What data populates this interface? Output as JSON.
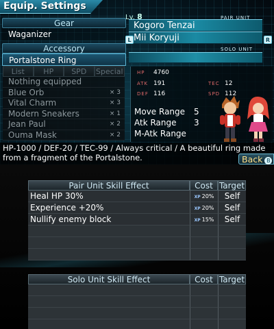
{
  "screen_title": "Equip. Settings",
  "gear": {
    "header": "Gear",
    "slot": "Waganizer"
  },
  "accessory": {
    "header": "Accessory",
    "slot": "Portalstone Ring"
  },
  "list_tabs": [
    "List",
    "HP",
    "SPD",
    "Special"
  ],
  "inventory": [
    {
      "name": "Nothing equipped",
      "qty": ""
    },
    {
      "name": "Blue Orb",
      "qty": "× 3"
    },
    {
      "name": "Vital Charm",
      "qty": "× 3"
    },
    {
      "name": "Modern Sneakers",
      "qty": "× 1"
    },
    {
      "name": "Jean Paul",
      "qty": "× 2"
    },
    {
      "name": "Ouma Mask",
      "qty": "× 2"
    }
  ],
  "level": {
    "label": "Lv.",
    "value": "8"
  },
  "pair_unit_label": "PAIR UNIT",
  "solo_unit_label": "SOLO UNIT",
  "units": {
    "unit1": "Kogoro Tenzai",
    "unit2": "Mii Koryuji"
  },
  "buttons": {
    "l": "L",
    "r": "R",
    "b": "B"
  },
  "stats": {
    "hp": {
      "k": "HP",
      "v": "4760"
    },
    "atk": {
      "k": "ATK",
      "v": "191"
    },
    "def": {
      "k": "DEF",
      "v": "116"
    },
    "tec": {
      "k": "TEC",
      "v": "12"
    },
    "spd": {
      "k": "SPD",
      "v": "112"
    }
  },
  "moves": {
    "move_range": {
      "label": "Move Range",
      "value": "5"
    },
    "atk_range": {
      "label": "Atk Range",
      "value": "3"
    },
    "matk_range": {
      "label": "M-Atk Range",
      "value": ""
    }
  },
  "description": "HP-1000 / DEF-20 / TEC-99 / Always critical / A beautiful ring made from a fragment of the Portalstone.",
  "back_label": "Back",
  "pair_skills": {
    "header": {
      "effect": "Pair Unit Skill Effect",
      "cost": "Cost",
      "target": "Target"
    },
    "rows": [
      {
        "effect": "Heal HP 30%",
        "cost": "20%",
        "target": "Self"
      },
      {
        "effect": "Experience +20%",
        "cost": "20%",
        "target": "Self"
      },
      {
        "effect": "Nullify enemy block",
        "cost": "15%",
        "target": "Self"
      }
    ],
    "xp_label": "XP"
  },
  "solo_skills": {
    "header": {
      "effect": "Solo Unit Skill Effect",
      "cost": "Cost",
      "target": "Target"
    }
  },
  "colors": {
    "accent": "#1a8aa3",
    "stat_key": "#e06a6a",
    "back": "#ffe18a"
  }
}
